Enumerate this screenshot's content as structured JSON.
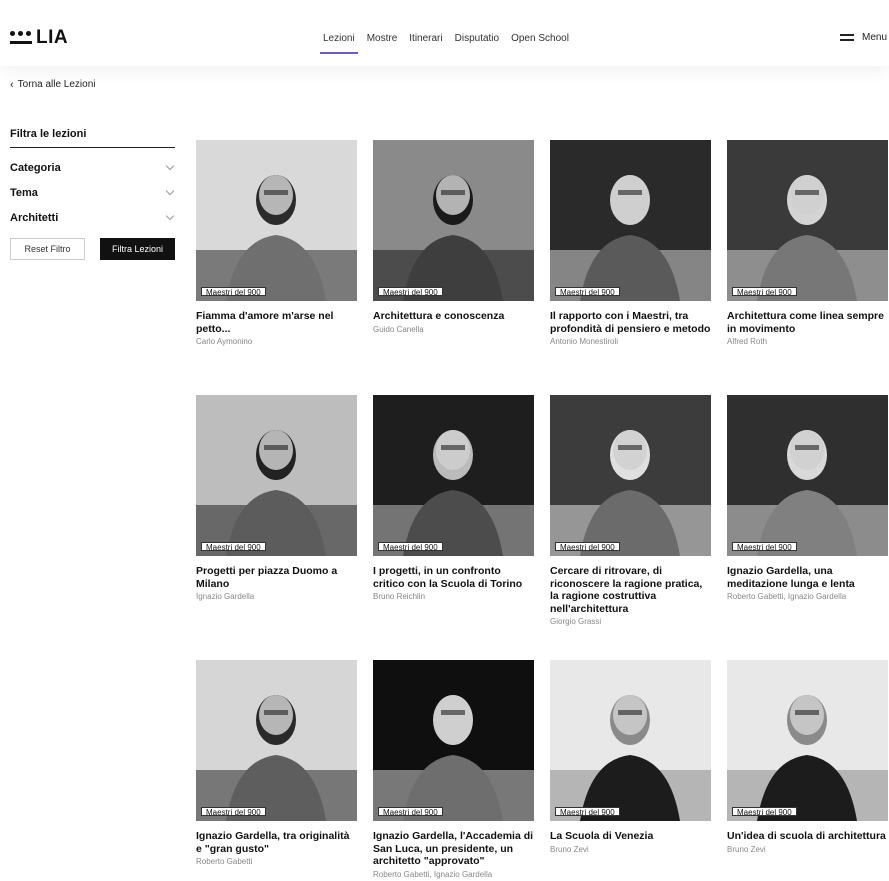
{
  "header": {
    "logo_text": "LIA",
    "nav": [
      "Lezioni",
      "Mostre",
      "Itinerari",
      "Disputatio",
      "Open School"
    ],
    "active_nav": "Lezioni",
    "menu_label": "Menu",
    "accent_color": "#6b5bd6"
  },
  "back_link": "Torna alle Lezioni",
  "sidebar": {
    "title": "Filtra le lezioni",
    "filters": [
      "Categoria",
      "Tema",
      "Architetti"
    ],
    "reset_label": "Reset Filtro",
    "apply_label": "Filtra Lezioni"
  },
  "cards": [
    {
      "badge": "Maestri del 900",
      "title": "Fiamma d'amore m'arse nel petto...",
      "author": "Carlo Aymonino",
      "image": "bw-photo-man-at-desk"
    },
    {
      "badge": "Maestri del 900",
      "title": "Architettura e conoscenza",
      "author": "Guido Canella",
      "image": "bw-photo-man-bookshelf"
    },
    {
      "badge": "Maestri del 900",
      "title": "Il rapporto con i Maestri, tra profondità di pensiero e metodo",
      "author": "Antonio Monestiroli",
      "image": "bw-photo-man-microphone"
    },
    {
      "badge": "Maestri del 900",
      "title": "Architettura come linea sempre in movimento",
      "author": "Alfred Roth",
      "image": "bw-photo-elderly-man"
    },
    {
      "badge": "Maestri del 900",
      "title": "Progetti per piazza Duomo a Milano",
      "author": "Ignazio Gardella",
      "image": "bw-photo-man-pointing-drawing"
    },
    {
      "badge": "Maestri del 900",
      "title": "I progetti, in un confronto critico con la Scuola di Torino",
      "author": "Bruno Reichlin",
      "image": "bw-photo-man-glasses-mic"
    },
    {
      "badge": "Maestri del 900",
      "title": "Cercare di ritrovare, di riconoscere la ragione pratica, la ragione costruttiva nell'architettura",
      "author": "Giorgio Grassi",
      "image": "bw-photo-man-speaking"
    },
    {
      "badge": "Maestri del 900",
      "title": "Ignazio Gardella, una meditazione lunga e lenta",
      "author": "Roberto Gabetti, Ignazio Gardella",
      "image": "bw-photo-elderly-man-mic"
    },
    {
      "badge": "Maestri del 900",
      "title": "Ignazio Gardella, tra originalità e \"gran gusto\"",
      "author": "Roberto Gabetti",
      "image": "bw-photo-two-men-table"
    },
    {
      "badge": "Maestri del 900",
      "title": "Ignazio Gardella, l'Accademia di San Luca, un presidente, un architetto \"approvato\"",
      "author": "Roberto Gabetti, Ignazio Gardella",
      "image": "bw-photo-conference-panel"
    },
    {
      "badge": "Maestri del 900",
      "title": "La Scuola di Venezia",
      "author": "Bruno Zevi",
      "image": "bw-photo-man-bowtie"
    },
    {
      "badge": "Maestri del 900",
      "title": "Un'idea di scuola di architettura",
      "author": "Bruno Zevi",
      "image": "bw-photo-man-bowtie"
    }
  ]
}
